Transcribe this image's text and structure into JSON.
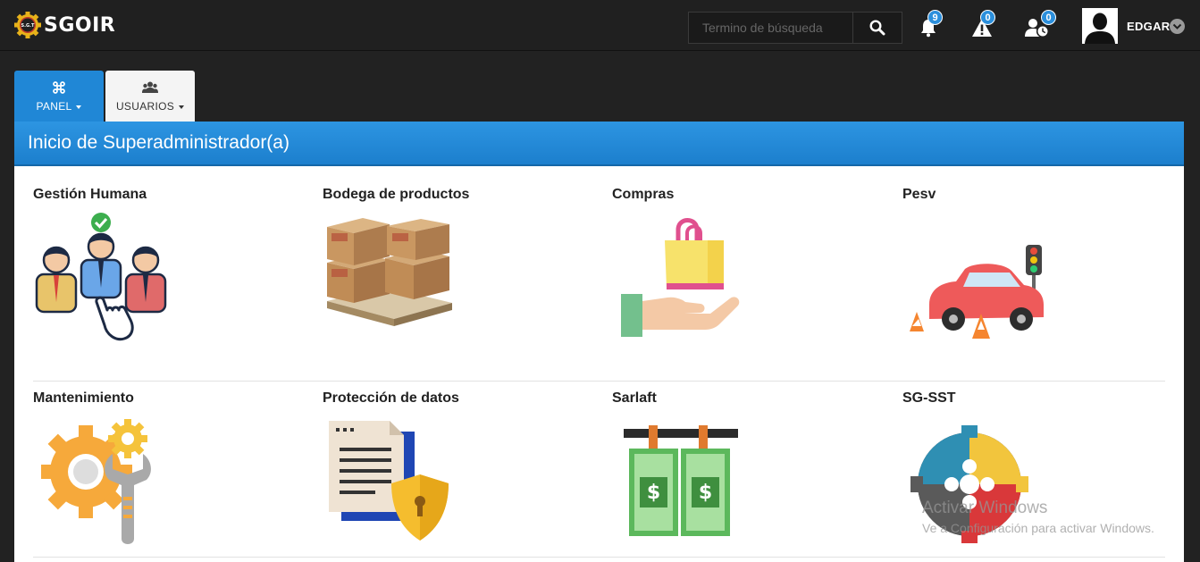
{
  "brand": {
    "name": "SGOIR",
    "badge_text": "S.G.T"
  },
  "search": {
    "placeholder": "Termino de búsqueda"
  },
  "notifications": [
    {
      "icon": "bell-icon",
      "count": "9"
    },
    {
      "icon": "warning-icon",
      "count": "0"
    },
    {
      "icon": "user-clock-icon",
      "count": "0"
    }
  ],
  "user": {
    "name": "EDGAR"
  },
  "tabs": [
    {
      "label": "PANEL",
      "icon": "command-icon",
      "active": true
    },
    {
      "label": "USUARIOS",
      "icon": "users-icon",
      "active": false
    }
  ],
  "page": {
    "title": "Inicio de Superadministrador(a)"
  },
  "modules": [
    {
      "title": "Gestión Humana",
      "icon": "team-selection-icon"
    },
    {
      "title": "Bodega de productos",
      "icon": "boxes-pallet-icon"
    },
    {
      "title": "Compras",
      "icon": "shopping-bag-hand-icon"
    },
    {
      "title": "Pesv",
      "icon": "car-traffic-icon"
    },
    {
      "title": "Mantenimiento",
      "icon": "gear-wrench-icon"
    },
    {
      "title": "Protección de datos",
      "icon": "document-shield-icon"
    },
    {
      "title": "Sarlaft",
      "icon": "money-laundering-icon"
    },
    {
      "title": "SG-SST",
      "icon": "puzzle-gear-icon"
    }
  ],
  "watermark": {
    "line1": "Activar Windows",
    "line2": "Ve a Configuración para activar Windows."
  },
  "colors": {
    "accent": "#2087d6",
    "topbar": "#202020",
    "badge": "#2b8fdc"
  }
}
